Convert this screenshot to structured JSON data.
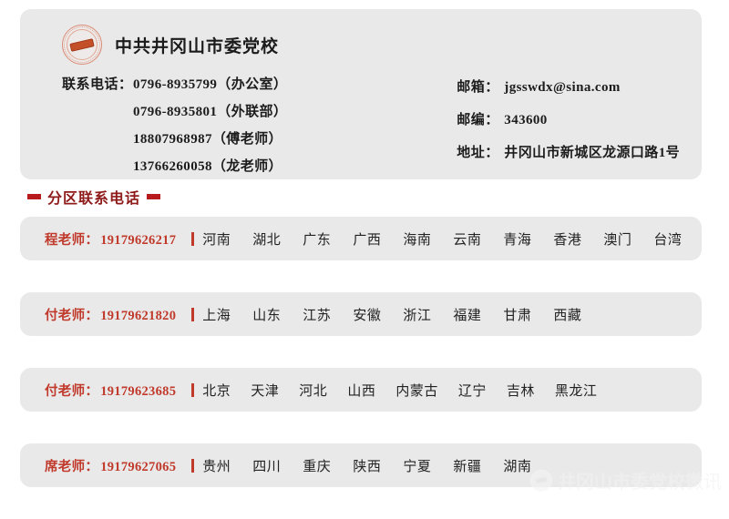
{
  "header": {
    "logo_icon": "school-seal-icon",
    "school_name": "中共井冈山市委党校"
  },
  "contact": {
    "phone_label": "联系电话：",
    "phones": [
      {
        "number": "0796-8935799",
        "note": "（办公室）"
      },
      {
        "number": "0796-8935801",
        "note": "（外联部）"
      },
      {
        "number": "18807968987",
        "note": "（傅老师）"
      },
      {
        "number": "13766260058",
        "note": "（龙老师）"
      }
    ],
    "email_label": "邮箱：",
    "email": "jgsswdx@sina.com",
    "postcode_label": "邮编：",
    "postcode": "343600",
    "address_label": "地址：",
    "address": "井冈山市新城区龙源口路1号"
  },
  "section": {
    "title": "分区联系电话",
    "left_dash_icon": "dash-icon",
    "right_dash_icon": "dash-icon"
  },
  "regions": [
    {
      "teacher": "程老师：",
      "phone": "19179626217",
      "provinces": [
        "河南",
        "湖北",
        "广东",
        "广西",
        "海南",
        "云南",
        "青海",
        "香港",
        "澳门",
        "台湾"
      ]
    },
    {
      "teacher": "付老师：",
      "phone": "19179621820",
      "provinces": [
        "上海",
        "山东",
        "江苏",
        "安徽",
        "浙江",
        "福建",
        "甘肃",
        "西藏"
      ]
    },
    {
      "teacher": "付老师：",
      "phone": "19179623685",
      "provinces": [
        "北京",
        "天津",
        "河北",
        "山西",
        "内蒙古",
        "辽宁",
        "吉林",
        "黑龙江"
      ]
    },
    {
      "teacher": "席老师：",
      "phone": "19179627065",
      "provinces": [
        "贵州",
        "四川",
        "重庆",
        "陕西",
        "宁夏",
        "新疆",
        "湖南"
      ]
    }
  ],
  "watermark": {
    "logo_icon": "watermark-logo-icon",
    "text": "井冈山市委党校微讯"
  },
  "colors": {
    "card_background": "#e9e9e9",
    "accent_red": "#c0392b",
    "title_red": "#8e1a1a",
    "dash_red": "#b81b1b",
    "text_dark": "#1c1c1c"
  }
}
